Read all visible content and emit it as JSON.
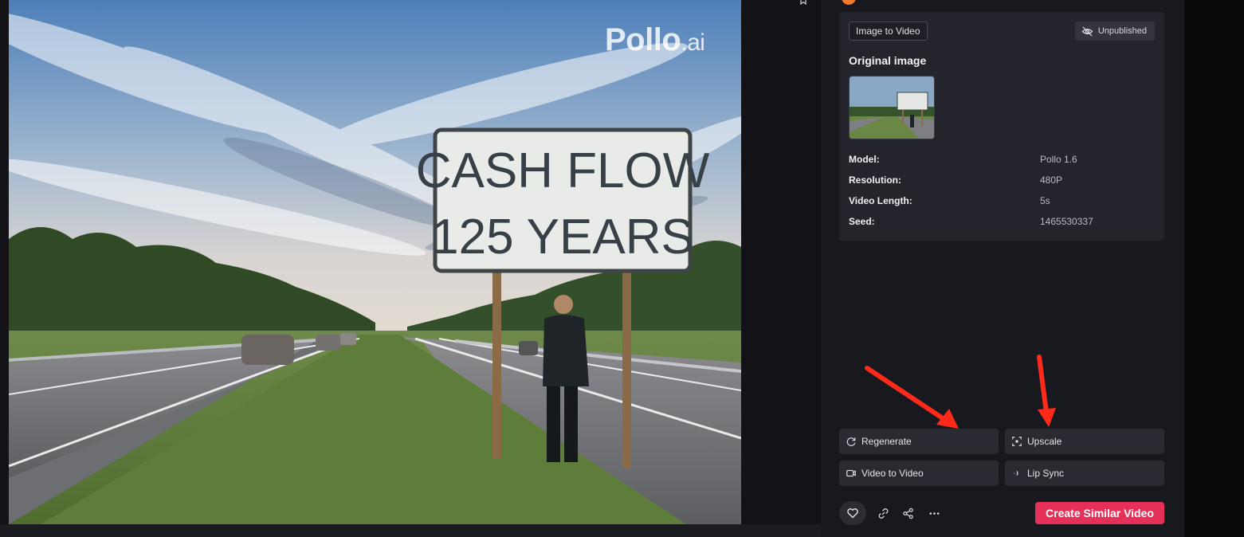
{
  "media": {
    "watermark_main": "Pollo",
    "watermark_suffix": ".ai",
    "sign_line1": "CASH FLOW",
    "sign_line2": "125 YEARS"
  },
  "card": {
    "type_tag": "Image to Video",
    "status": "Unpublished",
    "original_image_title": "Original image",
    "details": [
      {
        "label": "Model:",
        "value": "Pollo 1.6"
      },
      {
        "label": "Resolution:",
        "value": "480P"
      },
      {
        "label": "Video Length:",
        "value": "5s"
      },
      {
        "label": "Seed:",
        "value": "1465530337"
      }
    ]
  },
  "actions": {
    "regenerate": "Regenerate",
    "upscale": "Upscale",
    "video_to_video": "Video to Video",
    "lip_sync": "Lip Sync",
    "create_similar": "Create Similar Video"
  },
  "icons": [
    "bookmark-icon",
    "eye-off-icon",
    "refresh-icon",
    "upscale-icon",
    "video-icon",
    "audio-icon",
    "heart-icon",
    "link-icon",
    "share-icon",
    "more-icon"
  ],
  "colors": {
    "accent": "#e5305a",
    "panel_bg": "#18181f",
    "card_bg": "#24242d",
    "annotation_arrow": "#ff2a1a"
  }
}
